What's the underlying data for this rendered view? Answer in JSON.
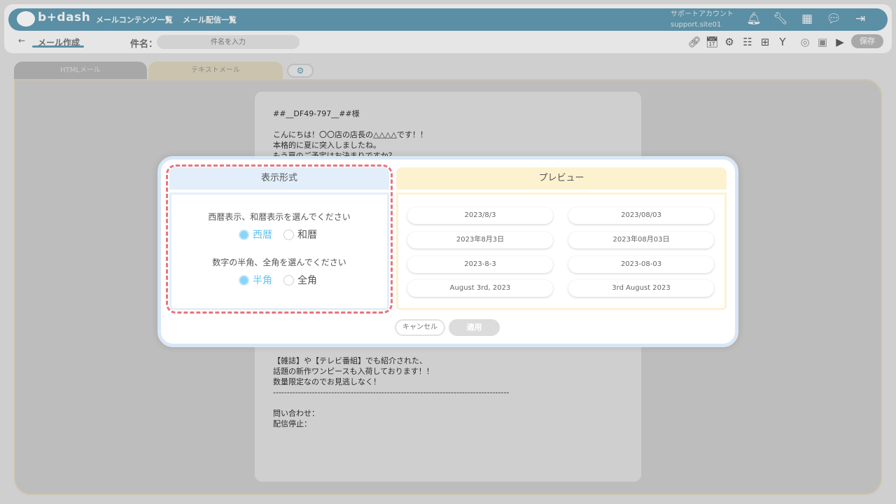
{
  "header": {
    "logo_text": "b+dash",
    "nav_links": [
      "メールコンテンツ一覧",
      "メール配信一覧"
    ],
    "account_name": "サポートアカウント",
    "account_site": "support.site01",
    "nav_icons": [
      "bell-icon",
      "wrench-icon",
      "grid-icon",
      "chat-icon",
      "logout-icon"
    ]
  },
  "toolbar": {
    "back_arrow": "←",
    "page_title": "メール作成",
    "subject_label": "件名：",
    "subject_placeholder": "件名を入力",
    "save_label": "保存",
    "tool_icons": [
      "link-icon",
      "calendar-icon",
      "settings-icon",
      "database-icon",
      "add-document-icon",
      "merge-icon",
      "hide-icon",
      "contact-icon",
      "play-icon"
    ]
  },
  "tabs": {
    "html_label": "HTMLメール",
    "text_label": "テキストメール"
  },
  "mail_body": {
    "top": "##__DF49-797__##様\n\nこんにちは！〇〇店の店長の△△△△です！！\n本格的に夏に突入しましたね。\nもう夏のご予定はお決まりですか？",
    "bottom": "【雑誌】や【テレビ番組】でも紹介された、\n話題の新作ワンピースも入荷しております！！\n数量限定なのでお見逃しなく！\n-------------------------------------------------------------------------------------\n\n問い合わせ：\n配信停止："
  },
  "modal": {
    "format_title": "表示形式",
    "preview_title": "プレビュー",
    "era_question": "西暦表示、和暦表示を選んでください",
    "era_options": [
      "西暦",
      "和暦"
    ],
    "era_selected": "西暦",
    "width_question": "数字の半角、全角を選んでください",
    "width_options": [
      "半角",
      "全角"
    ],
    "width_selected": "半角",
    "preview_items": [
      "2023/8/3",
      "2023/08/03",
      "2023年8月3日",
      "2023年08月03日",
      "2023-8-3",
      "2023-08-03",
      "August 3rd, 2023",
      "3rd August 2023"
    ],
    "cancel_label": "キャンセル",
    "apply_label": "適用"
  },
  "colors": {
    "accent_blue": "#5ec4f2",
    "highlight_red": "#e8757b",
    "format_header_bg": "#e2effa",
    "preview_header_bg": "#fdf2d0"
  }
}
